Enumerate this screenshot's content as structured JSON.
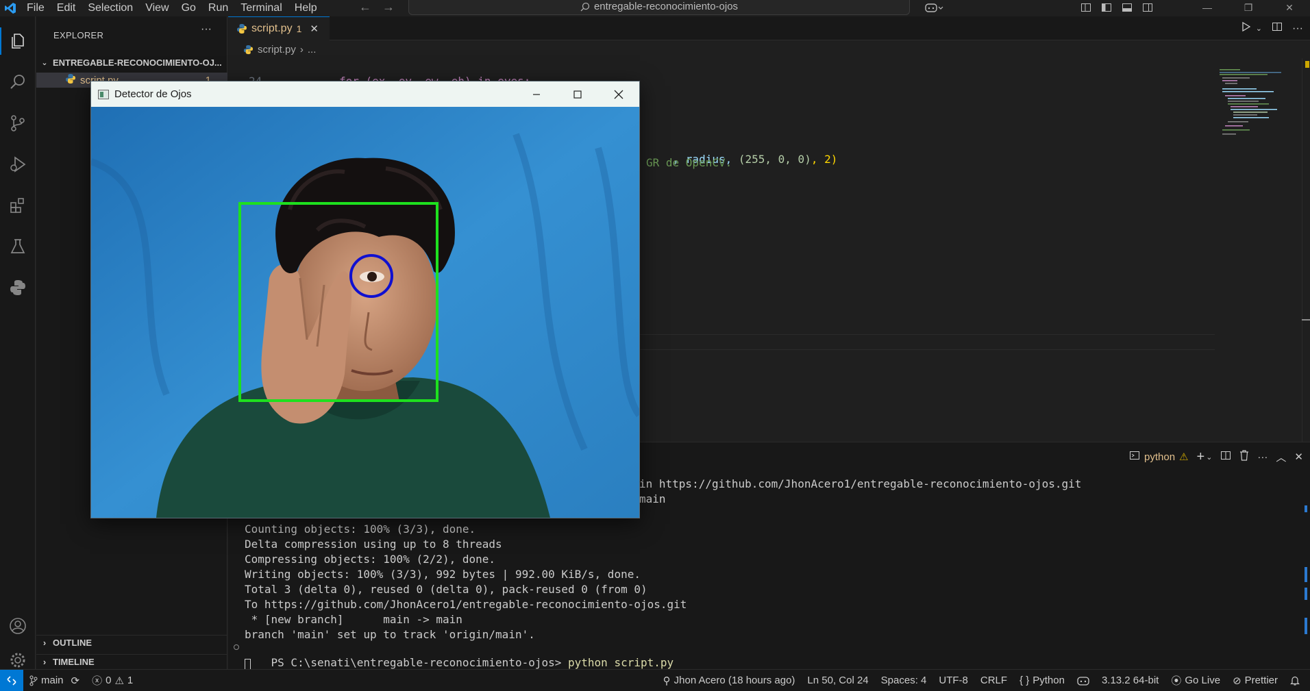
{
  "menu": [
    "File",
    "Edit",
    "Selection",
    "View",
    "Go",
    "Run",
    "Terminal",
    "Help"
  ],
  "command_center": {
    "text": "entregable-reconocimiento-ojos"
  },
  "sidebar": {
    "title": "EXPLORER",
    "folder": "ENTREGABLE-RECONOCIMIENTO-OJ...",
    "file": {
      "name": "script.py",
      "badge": "1"
    },
    "outline": "OUTLINE",
    "timeline": "TIMELINE"
  },
  "tab": {
    "name": "script.py",
    "badge": "1"
  },
  "breadcrumb": {
    "file": "script.py",
    "rest": "..."
  },
  "editor": {
    "line_number": "24",
    "line1": "for (ex, ey, ew, eh) in eyes:",
    "line2_a": ", radius, ",
    "line2_b": "(255, 0, 0)",
    "line2_c": ", 2)",
    "line3": "GR de OpenCV."
  },
  "terminal": {
    "profile": "python",
    "lines": [
      "in https://github.com/JhonAcero1/entregable-reconocimiento-ojos.git",
      "main",
      "Counting objects: 100% (3/3), done.",
      "Delta compression using up to 8 threads",
      "Compressing objects: 100% (2/2), done.",
      "Writing objects: 100% (3/3), 992 bytes | 992.00 KiB/s, done.",
      "Total 3 (delta 0), reused 0 (delta 0), pack-reused 0 (from 0)",
      "To https://github.com/JhonAcero1/entregable-reconocimiento-ojos.git",
      " * [new branch]      main -> main",
      "branch 'main' set up to track 'origin/main'."
    ],
    "prompt": "PS C:\\senati\\entregable-reconocimiento-ojos> ",
    "command": "python script.py"
  },
  "statusbar": {
    "branch": "main",
    "errors": "0",
    "warnings": "1",
    "blame": "Jhon Acero (18 hours ago)",
    "position": "Ln 50, Col 24",
    "spaces": "Spaces: 4",
    "encoding": "UTF-8",
    "eol": "CRLF",
    "language": "Python",
    "interpreter": "3.13.2 64-bit",
    "golive": "Go Live",
    "prettier": "Prettier"
  },
  "detector_window": {
    "title": "Detector de Ojos"
  },
  "colors": {
    "accent": "#0078d4",
    "face_box": "#1ee01e",
    "eye_circle": "#1010d0",
    "backdrop": "#2a7fc2",
    "warning": "#cca700",
    "terminal_command": "#dcdcaa"
  },
  "icons": [
    "vscode-logo-icon",
    "files-icon",
    "search-icon",
    "source-control-icon",
    "run-debug-icon",
    "extensions-icon",
    "testing-icon",
    "python-icon",
    "account-icon",
    "settings-gear-icon",
    "copilot-icon"
  ]
}
